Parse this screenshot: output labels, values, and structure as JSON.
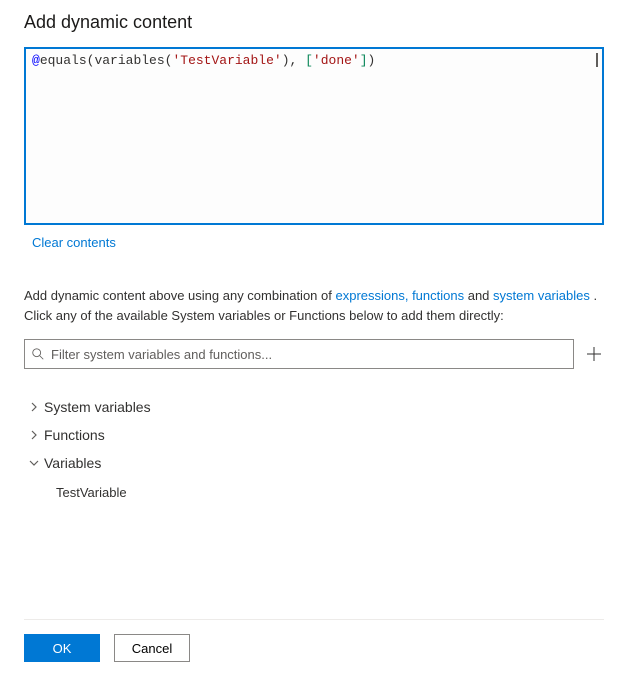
{
  "dialog": {
    "title": "Add dynamic content"
  },
  "editor": {
    "expression": {
      "at": "@",
      "fn1": "equals",
      "p1": "(",
      "fn2": "variables",
      "p2": "(",
      "str1": "'TestVariable'",
      "p3": ")",
      "comma": ", ",
      "b1": "[",
      "str2": "'done'",
      "b2": "]",
      "p4": ")"
    }
  },
  "actions": {
    "clear": "Clear contents"
  },
  "hint": {
    "prefix": "Add dynamic content above using any combination of ",
    "link1": "expressions, functions",
    "mid1": " and ",
    "link2": "system variables",
    "mid2": " . Click any of the available System variables or Functions below to add them directly:"
  },
  "filter": {
    "placeholder": "Filter system variables and functions..."
  },
  "tree": {
    "systemVariables": "System variables",
    "functions": "Functions",
    "variables": "Variables",
    "items": {
      "0": "TestVariable"
    }
  },
  "footer": {
    "ok": "OK",
    "cancel": "Cancel"
  }
}
